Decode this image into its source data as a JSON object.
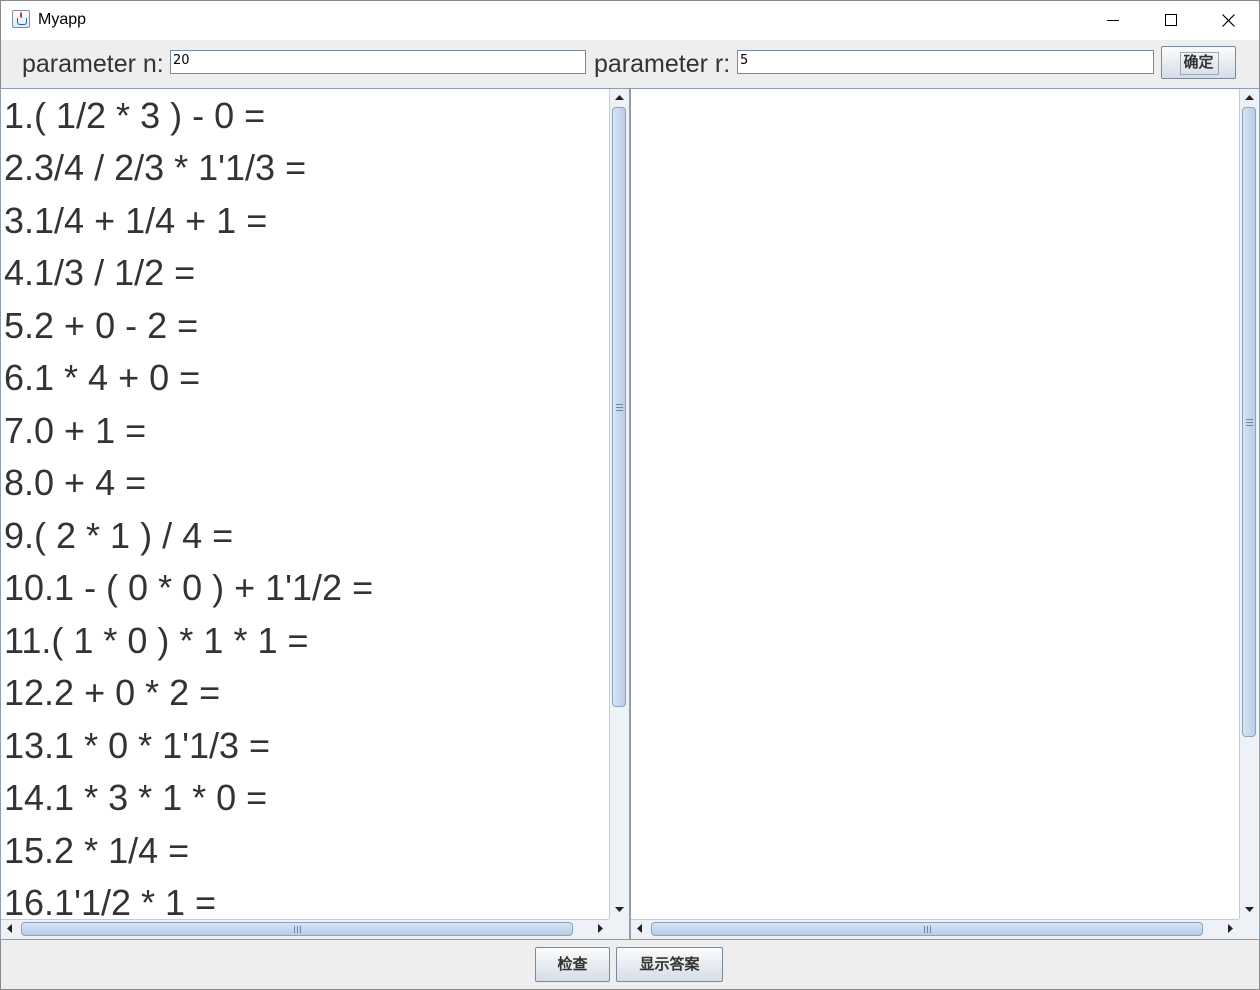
{
  "window": {
    "title": "Myapp"
  },
  "toolbar": {
    "n_label": "parameter n:",
    "n_value": "20",
    "r_label": "parameter r:",
    "r_value": "5",
    "confirm_label": "确定"
  },
  "questions": [
    "1.( 1/2 * 3 ) - 0 =",
    "2.3/4 / 2/3 * 1'1/3 =",
    "3.1/4 + 1/4 + 1 =",
    "4.1/3 / 1/2 =",
    "5.2 + 0 - 2 =",
    "6.1 * 4 + 0 =",
    "7.0 + 1 =",
    "8.0 + 4 =",
    "9.( 2 * 1 ) / 4 =",
    "10.1 - ( 0 * 0 ) + 1'1/2 =",
    "11.( 1 * 0 ) * 1 * 1 =",
    "12.2 + 0 * 2 =",
    "13.1 * 0 * 1'1/3 =",
    "14.1 * 3 * 1 * 0 =",
    "15.2 * 1/4 =",
    "16.1'1/2 * 1 ="
  ],
  "answers": [],
  "footer": {
    "check_label": "检查",
    "show_answer_label": "显示答案"
  },
  "icons": {
    "app": "java-cup-icon",
    "minimize": "minimize-icon",
    "maximize": "maximize-icon",
    "close": "close-icon"
  }
}
